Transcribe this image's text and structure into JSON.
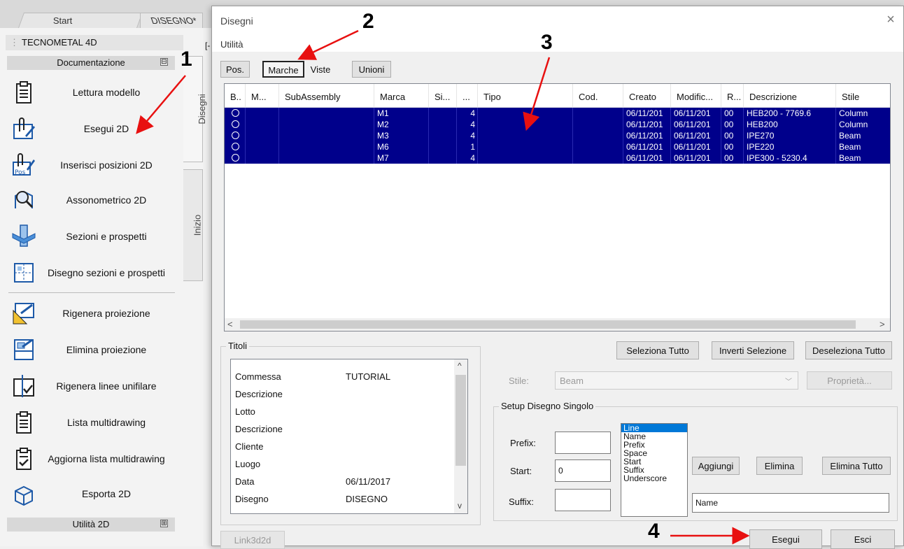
{
  "app_tabs": {
    "start": "Start",
    "drawing": "DISEGNO*"
  },
  "panel": {
    "title": "TECNOMETAL 4D",
    "section": "Documentazione",
    "section_toggle": "⊟",
    "bottom_section": "Utilità 2D",
    "bottom_toggle": "⊞",
    "partial_label": "[-"
  },
  "commands": [
    {
      "label": "Lettura modello",
      "icon": "clipboard-icon"
    },
    {
      "label": "Esegui 2D",
      "icon": "paperclip-edit-icon"
    },
    {
      "label": "Inserisci posizioni 2D",
      "icon": "paperclip-pos-icon"
    },
    {
      "label": "Assonometrico 2D",
      "icon": "magnifier-frame-icon"
    },
    {
      "label": "Sezioni e prospetti",
      "icon": "section-icon"
    },
    {
      "label": "Disegno sezioni e prospetti",
      "icon": "sections-drawing-icon"
    },
    {
      "label": "Rigenera proiezione",
      "icon": "regenerate-projection-icon"
    },
    {
      "label": "Elimina proiezione",
      "icon": "delete-projection-icon"
    },
    {
      "label": "Rigenera linee unifilare",
      "icon": "regenerate-lines-icon"
    },
    {
      "label": "Lista multidrawing",
      "icon": "list-icon"
    },
    {
      "label": "Aggiorna lista multidrawing",
      "icon": "update-list-icon"
    },
    {
      "label": "Esporta 2D",
      "icon": "export-icon"
    }
  ],
  "side_tabs": {
    "disegni": "Disegni",
    "inizio": "Inizio"
  },
  "dialog": {
    "title": "Disegni",
    "close": "×",
    "menu": "Utilità",
    "tabs": [
      "Pos.",
      "Marche",
      "Viste",
      "Unioni"
    ],
    "columns": [
      "B..",
      "M...",
      "SubAssembly",
      "Marca",
      "Si...",
      "...",
      "Tipo",
      "Cod.",
      "Creato",
      "Modific...",
      "R...",
      "Descrizione",
      "Stile"
    ],
    "rows": [
      {
        "marca": "M1",
        "qty": "4",
        "created": "06/11/201",
        "modified": "06/11/201",
        "rev": "00",
        "desc": "HEB200 - 7769.6",
        "style": "Column"
      },
      {
        "marca": "M2",
        "qty": "4",
        "created": "06/11/201",
        "modified": "06/11/201",
        "rev": "00",
        "desc": "HEB200",
        "style": "Column"
      },
      {
        "marca": "M3",
        "qty": "4",
        "created": "06/11/201",
        "modified": "06/11/201",
        "rev": "00",
        "desc": "IPE270",
        "style": "Beam"
      },
      {
        "marca": "M6",
        "qty": "1",
        "created": "06/11/201",
        "modified": "06/11/201",
        "rev": "00",
        "desc": "IPE220",
        "style": "Beam"
      },
      {
        "marca": "M7",
        "qty": "4",
        "created": "06/11/201",
        "modified": "06/11/201",
        "rev": "00",
        "desc": "IPE300 - 5230.4",
        "style": "Beam"
      }
    ],
    "scroll_left": "<",
    "scroll_right": ">",
    "titoli_label": "Titoli",
    "titoli": [
      {
        "k": "Commessa",
        "v": "TUTORIAL"
      },
      {
        "k": "Descrizione",
        "v": ""
      },
      {
        "k": "Lotto",
        "v": ""
      },
      {
        "k": "Descrizione",
        "v": ""
      },
      {
        "k": "Cliente",
        "v": ""
      },
      {
        "k": "Luogo",
        "v": ""
      },
      {
        "k": "Data",
        "v": "06/11/2017"
      },
      {
        "k": "Disegno",
        "v": "DISEGNO"
      }
    ],
    "scroll_up": "^",
    "scroll_down": "v",
    "select_all": "Seleziona Tutto",
    "invert": "Inverti Selezione",
    "deselect_all": "Deseleziona Tutto",
    "style_label": "Stile:",
    "style_value": "Beam",
    "properties": "Proprietà...",
    "setup_label": "Setup Disegno Singolo",
    "prefix_label": "Prefix:",
    "start_label": "Start:",
    "suffix_label": "Suffix:",
    "prefix_value": "",
    "start_value": "0",
    "suffix_value": "",
    "list_options": [
      "Line",
      "Name",
      "Prefix",
      "Space",
      "Start",
      "Suffix",
      "Underscore"
    ],
    "add": "Aggiungi",
    "delete": "Elimina",
    "delete_all": "Elimina Tutto",
    "format_value": "Name",
    "link_btn": "Link3d2d",
    "run": "Esegui",
    "exit": "Esci"
  },
  "annotations": [
    "1",
    "2",
    "3",
    "4"
  ],
  "colors": {
    "selection": "#00008b",
    "annotation": "#e81010"
  }
}
